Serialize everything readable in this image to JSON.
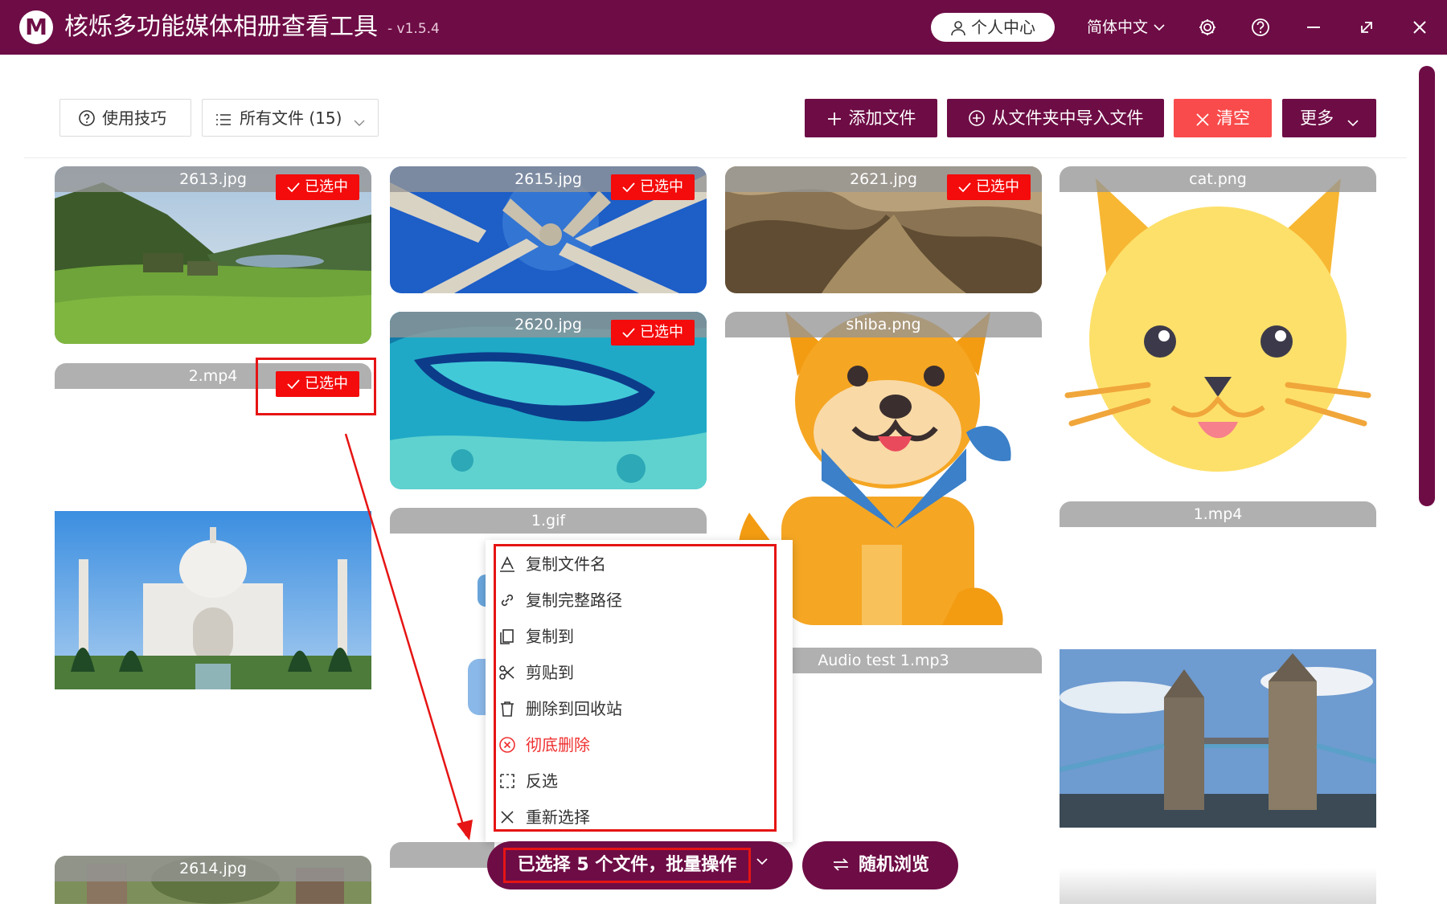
{
  "app": {
    "title": "核烁多功能媒体相册查看工具",
    "version": "- v1.5.4",
    "logo_letter": "M",
    "user_center": "个人中心",
    "language": "简体中文",
    "accent_color": "#6e0c45"
  },
  "toolbar": {
    "tips": "使用技巧",
    "all_files": "所有文件 (15)",
    "add_files": "添加文件",
    "import_folder": "从文件夹中导入文件",
    "clear": "清空",
    "more": "更多"
  },
  "tiles": [
    {
      "name": "2613.jpg",
      "selected": true
    },
    {
      "name": "2615.jpg",
      "selected": true
    },
    {
      "name": "2621.jpg",
      "selected": true
    },
    {
      "name": "cat.png",
      "selected": false
    },
    {
      "name": "2620.jpg",
      "selected": true
    },
    {
      "name": "shiba.png",
      "selected": false
    },
    {
      "name": "2.mp4",
      "selected": true
    },
    {
      "name": "1.gif",
      "selected": false
    },
    {
      "name": "1.mp4",
      "selected": false
    },
    {
      "name": "Audio test 1.mp3",
      "selected": false
    },
    {
      "name": "2614.jpg",
      "selected": false
    }
  ],
  "selected_label": "已选中",
  "context_menu": [
    {
      "label": "复制文件名",
      "icon": "text-icon"
    },
    {
      "label": "复制完整路径",
      "icon": "link-icon"
    },
    {
      "label": "复制到",
      "icon": "copy-icon"
    },
    {
      "label": "剪贴到",
      "icon": "scissors-icon"
    },
    {
      "label": "删除到回收站",
      "icon": "trash-icon"
    },
    {
      "label": "彻底删除",
      "icon": "delete-circle-icon"
    },
    {
      "label": "反选",
      "icon": "invert-select-icon"
    },
    {
      "label": "重新选择",
      "icon": "close-icon"
    }
  ],
  "footer": {
    "batch": "已选择 5 个文件，批量操作",
    "random": "随机浏览"
  }
}
